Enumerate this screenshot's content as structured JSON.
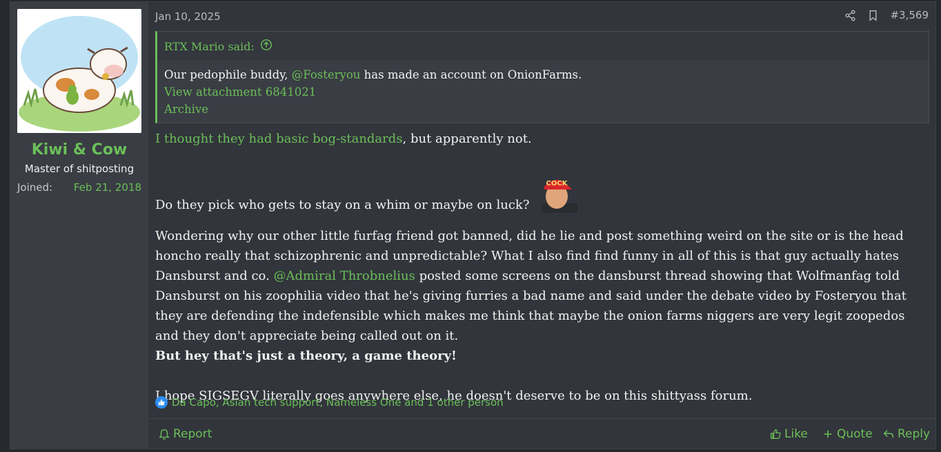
{
  "user": {
    "name": "Kiwi & Cow",
    "title": "Master of shitposting",
    "joined_label": "Joined:",
    "joined_date": "Feb 21, 2018"
  },
  "post": {
    "date": "Jan 10, 2025",
    "number": "#3,569"
  },
  "quote": {
    "author_said": "RTX Mario said:",
    "line1_before": "Our pedophile buddy, ",
    "line1_mention": "@Fosteryou",
    "line1_after": " has made an account on OnionFarms.",
    "attachment_link": "View attachment 6841021",
    "archive_link": "Archive"
  },
  "content": {
    "p1_link": "I thought they had basic bog-standards",
    "p1_rest": ", but apparently not.",
    "p2": "Do they pick who gets to stay on a whim or maybe on luck?",
    "emoji_hat_text": "COCK",
    "p3_before": "Wondering why our other little furfag friend got banned, did he lie and post something weird on the site or is the head honcho really that schizophrenic and unpredictable? What I also find find funny in all of this is that guy actually hates Dansburst and co. ",
    "p3_mention": "@Admiral Throbnelius",
    "p3_after": " posted some screens on the dansburst thread showing that Wolfmanfag told Dansburst on his zoophilia video that he's giving furries a bad name and said under the debate video by Fosteryou that they are defending the indefensible which makes me think that maybe the onion farms niggers are very legit zoopedos and they don't appreciate being called out on it.",
    "p4_bold": "But hey that's just a theory, a game theory!",
    "p5": "I hope SIGSEGV literally goes anywhere else, he doesn't deserve to be on this shittyass forum."
  },
  "reactions": {
    "text": "Da Capo, Asian tech support, Nameless One and 1 other person"
  },
  "footer": {
    "report": "Report",
    "like": "Like",
    "quote": "Quote",
    "reply": "Reply"
  },
  "colors": {
    "accent": "#6bbf59",
    "background": "#32353b",
    "sidebar": "#3a3d44"
  }
}
